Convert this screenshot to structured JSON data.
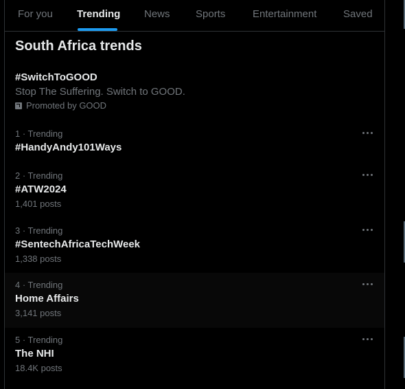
{
  "tabs": [
    {
      "label": "For you",
      "active": false
    },
    {
      "label": "Trending",
      "active": true
    },
    {
      "label": "News",
      "active": false
    },
    {
      "label": "Sports",
      "active": false
    },
    {
      "label": "Entertainment",
      "active": false
    },
    {
      "label": "Saved",
      "active": false
    }
  ],
  "section_title": "South Africa trends",
  "promoted": {
    "tag": "#SwitchToGOOD",
    "description": "Stop The Suffering. Switch to GOOD.",
    "promoted_by": "Promoted by GOOD"
  },
  "trends": [
    {
      "meta": "1 · Trending",
      "name": "#HandyAndy101Ways",
      "posts": ""
    },
    {
      "meta": "2 · Trending",
      "name": "#ATW2024",
      "posts": "1,401 posts"
    },
    {
      "meta": "3 · Trending",
      "name": "#SentechAfricaTechWeek",
      "posts": "1,338 posts"
    },
    {
      "meta": "4 · Trending",
      "name": "Home Affairs",
      "posts": "3,141 posts"
    },
    {
      "meta": "5 · Trending",
      "name": "The NHI",
      "posts": "18.4K posts"
    }
  ],
  "colors": {
    "accent": "#1d9bf0",
    "background": "#000000",
    "text_primary": "#e7e9ea",
    "text_secondary": "#71767b"
  }
}
